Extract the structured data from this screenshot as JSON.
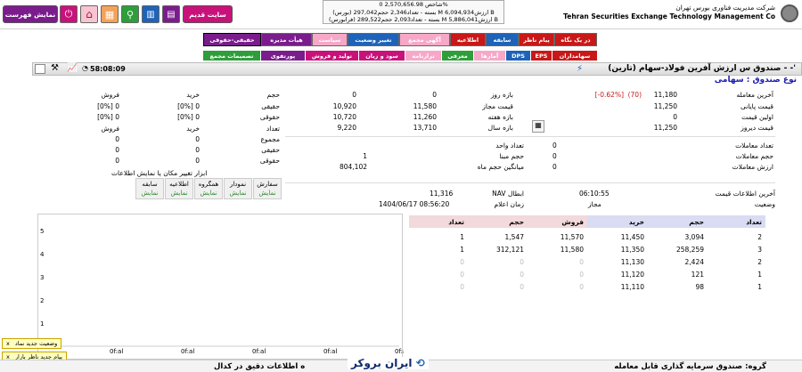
{
  "header": {
    "btn_show_list": "نمایش فهرست",
    "btn_old_site": "سایت قدیم",
    "index_lines": [
      "شاخص 2,570,656.98 0%",
      "(بورس) بسته - تعداد2,346 حجم297,042 M ارزش6,094,934 B",
      "(فرابورس) بسته - تعداد2,093 حجم289,522 M ارزش5,886,041 B"
    ],
    "company_fa": "شرکت مدیریت فناوری بورس تهران",
    "company_en": "Tehran Securities Exchange Technology Management Co",
    "colors": {
      "purple": "#7a1c8c",
      "magenta": "#c8127a",
      "green": "#2e9e3a",
      "red": "#c81818"
    }
  },
  "tabs_row1": [
    "در یک نگاه",
    "پیام ناظر",
    "سابقه",
    "اطلاعیه",
    "آگهی مجمع",
    "تغییر وضعیت",
    "سیاست",
    "هیأت مدیره",
    "حقیقی-حقوقی"
  ],
  "tabs_row2": [
    "سهامداران",
    "EPS",
    "DPS",
    "آمارها",
    "معرفی",
    "ترازنامه",
    "سود و زیان",
    "تولید و فروش",
    "پورتفوی",
    "تصمیمات مجمع"
  ],
  "titlebar": {
    "time": "58:08:09",
    "title": "صندوق س ارزش آفرین فولاد-سهام (تارین) - -'",
    "fund_type": "نوع صندوق : سهامی"
  },
  "price": {
    "rows": [
      {
        "label": "آخرین معامله",
        "value": "11,180",
        "change": "(70)",
        "pct": "[-0.62%]"
      },
      {
        "label": "قیمت پایانی",
        "value": "11,250"
      },
      {
        "label": "اولین قیمت",
        "value": "0"
      },
      {
        "label": "قیمت دیروز",
        "value": "11,250"
      }
    ]
  },
  "ranges": {
    "rows": [
      {
        "label": "بازه روز",
        "a": "0",
        "b": "0"
      },
      {
        "label": "قیمت مجاز",
        "a": "11,580",
        "b": "10,920"
      },
      {
        "label": "بازه هفته",
        "a": "11,260",
        "b": "10,720"
      },
      {
        "label": "بازه سال",
        "a": "13,710",
        "b": "9,220"
      }
    ]
  },
  "trades": {
    "rows": [
      {
        "label": "تعداد معاملات",
        "value": "0"
      },
      {
        "label": "حجم معاملات",
        "value": "0"
      },
      {
        "label": "ارزش معاملات",
        "value": "0"
      }
    ]
  },
  "unit": {
    "rows": [
      {
        "label": "تعداد واحد",
        "value": ""
      },
      {
        "label": "حجم مبنا",
        "value": "1"
      },
      {
        "label": "میانگین حجم ماه",
        "value": "804,102"
      }
    ]
  },
  "client": {
    "head": [
      "حجم",
      "خرید",
      "فروش"
    ],
    "rows": [
      {
        "label": "حقیقی",
        "buy": "[0%] 0",
        "sell": "[0%] 0"
      },
      {
        "label": "حقوقی",
        "buy": "[0%] 0",
        "sell": "[0%] 0"
      }
    ],
    "head2": [
      "تعداد",
      "خرید",
      "فروش"
    ],
    "rows2": [
      {
        "label": "مجموع",
        "buy": "0",
        "sell": "0"
      },
      {
        "label": "حقیقی",
        "buy": "0",
        "sell": "0"
      },
      {
        "label": "حقوقی",
        "buy": "0",
        "sell": "0"
      }
    ]
  },
  "info_tools": {
    "caption": "ابزار تغییر مکان یا نمایش اطلاعات",
    "buttons": [
      {
        "label": "سفارش",
        "show": "نمایش"
      },
      {
        "label": "نمودار",
        "show": "نمایش"
      },
      {
        "label": "همگروه",
        "show": "نمایش"
      },
      {
        "label": "اطلاعیه",
        "show": "نمایش"
      },
      {
        "label": "سابقه",
        "show": "نمایش"
      }
    ]
  },
  "nav": {
    "last_info_label": "آخرین اطلاعات قیمت",
    "last_info_time": "06:10:55",
    "status_label": "وضعیت",
    "status_value": "مجاز",
    "nav_label": "NAV ابطال",
    "nav_value": "11,316",
    "announce_label": "زمان اعلام",
    "announce_value": "1404/06/17 08:56:20"
  },
  "orderbook": {
    "headers": [
      "تعداد",
      "حجم",
      "خرید",
      "فروش",
      "حجم",
      "تعداد"
    ],
    "rows": [
      {
        "bc": "2",
        "bv": "3,094",
        "bp": "11,450",
        "sp": "11,570",
        "sv": "1,547",
        "sc": "1"
      },
      {
        "bc": "3",
        "bv": "258,259",
        "bp": "11,350",
        "sp": "11,580",
        "sv": "312,121",
        "sc": "1"
      },
      {
        "bc": "2",
        "bv": "2,424",
        "bp": "11,130",
        "sp": "0",
        "sv": "0",
        "sc": "0"
      },
      {
        "bc": "1",
        "bv": "121",
        "bp": "11,120",
        "sp": "0",
        "sv": "0",
        "sc": "0"
      },
      {
        "bc": "1",
        "bv": "98",
        "bp": "11,110",
        "sp": "0",
        "sv": "0",
        "sc": "0"
      }
    ]
  },
  "chart_data": {
    "type": "line",
    "yticks": [
      "5",
      "4",
      "3",
      "2",
      "1"
    ],
    "xticks": [
      "0f:al",
      "0f:al",
      "0f:al",
      "0f:al",
      "0f:al"
    ]
  },
  "notes": [
    {
      "text": "وضعیت جدید نماد",
      "close": "x"
    },
    {
      "text": "پیام جدید ناظر بازار",
      "close": "x"
    }
  ],
  "bottom": {
    "group": "گروه: صندوق سرمایه گذاری قابل معامله",
    "info": "ه اطلاعات دقیق در کدال",
    "brand": "ایران بروکر"
  }
}
